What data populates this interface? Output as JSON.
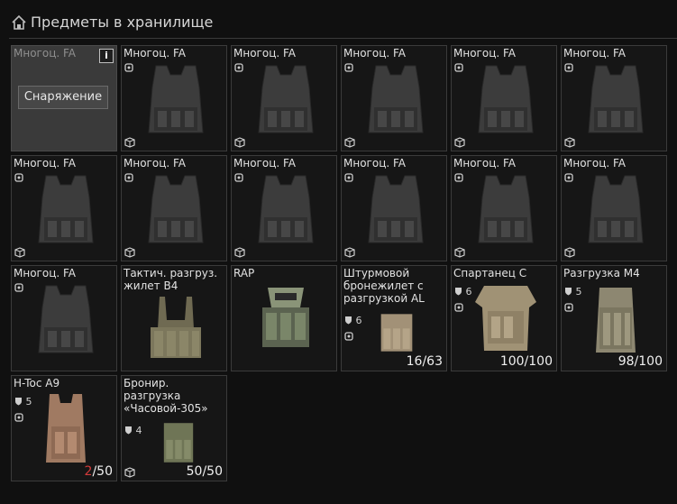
{
  "header": {
    "title": "Предметы в хранилище",
    "icon": "home-icon"
  },
  "context_menu": {
    "info_label": "i",
    "equipment_label": "Снаряжение"
  },
  "items": [
    {
      "name": "Многоц. FA"
    },
    {
      "name": "Многоц. FA"
    },
    {
      "name": "Многоц. FA"
    },
    {
      "name": "Многоц. FA"
    },
    {
      "name": "Многоц. FA"
    },
    {
      "name": "Многоц. FA"
    },
    {
      "name": "Многоц. FA"
    },
    {
      "name": "Многоц. FA"
    },
    {
      "name": "Многоц. FA"
    },
    {
      "name": "Многоц. FA"
    },
    {
      "name": "Многоц. FA"
    },
    {
      "name": "Многоц. FA"
    },
    {
      "name": "Многоц. FA"
    },
    {
      "name": "Тактич. разгруз. жилет В4"
    },
    {
      "name": "RAP"
    },
    {
      "name": "Штурмовой бронежилет с разгрузкой AL",
      "armor": "6",
      "durability": "16/63"
    },
    {
      "name": "Спартанец С",
      "armor": "6",
      "durability": "100/100"
    },
    {
      "name": "Разгрузка М4",
      "armor": "5",
      "durability": "98/100"
    },
    {
      "name": "H-Toc A9",
      "armor": "5",
      "durability_current": "2",
      "durability_max": "/50"
    },
    {
      "name": "Бронир. разгрузка «Часовой-305»",
      "armor": "4",
      "durability": "50/50"
    }
  ]
}
